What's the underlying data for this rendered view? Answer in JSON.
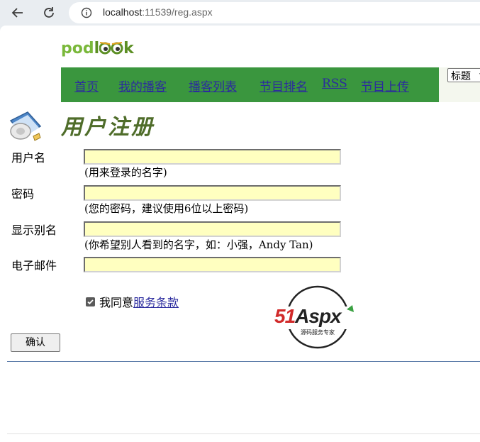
{
  "browser": {
    "url_host": "localhost",
    "url_rest": ":11539/reg.aspx"
  },
  "logo": {
    "part1": "pod",
    "part2": "l",
    "part3": "k"
  },
  "nav": {
    "items": [
      "首页",
      "我的播客",
      "播客列表",
      "节目排名",
      "RSS",
      "节目上传"
    ]
  },
  "search": {
    "selected": "标题"
  },
  "page": {
    "title": "用户注册"
  },
  "form": {
    "username_label": "用户名",
    "username_hint": "(用来登录的名字)",
    "password_label": "密码",
    "password_hint": "(您的密码，建议使用6位以上密码)",
    "display_label": "显示别名",
    "display_hint": "(你希望别人看到的名字，如：小强，Andy Tan)",
    "email_label": "电子邮件",
    "agree_text": "我同意",
    "agree_link": "服务条款",
    "agree_checked": true,
    "submit_label": "确认"
  },
  "brand": {
    "text": "51Aspx",
    "sub": "源码服务专家"
  },
  "colors": {
    "nav_bg": "#3a963e",
    "input_bg": "#ffffc0",
    "title": "#4f6d2a",
    "link": "#2b2b9e"
  }
}
